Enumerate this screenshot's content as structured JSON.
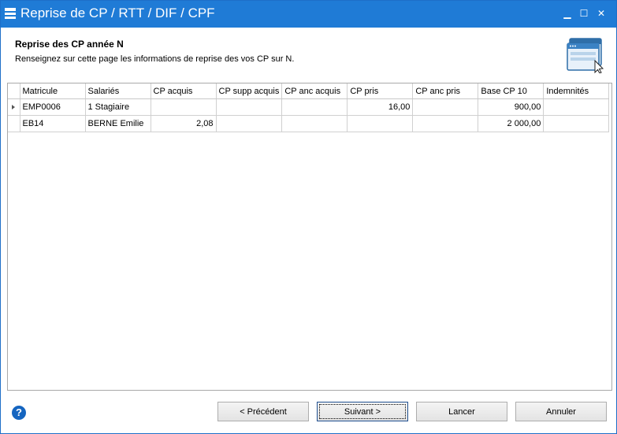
{
  "window": {
    "title": "Reprise de CP / RTT / DIF / CPF",
    "minimize_symbol": "▁",
    "maximize_symbol": "☐",
    "close_symbol": "✕"
  },
  "header": {
    "title": "Reprise des CP année N",
    "subtitle": "Renseignez sur cette page les informations de reprise des vos CP sur N.",
    "icon": "wizard-window-icon"
  },
  "grid": {
    "columns": [
      "Matricule",
      "Salariés",
      "CP acquis",
      "CP supp acquis",
      "CP anc acquis",
      "CP pris",
      "CP anc pris",
      "Base CP 10",
      "Indemnités"
    ],
    "rows": [
      {
        "current": true,
        "cells": [
          "EMP0006",
          "1 Stagiaire",
          "",
          "",
          "",
          "16,00",
          "",
          "900,00",
          ""
        ]
      },
      {
        "current": false,
        "cells": [
          "EB14",
          "BERNE Emilie",
          "2,08",
          "",
          "",
          "",
          "",
          "2 000,00",
          ""
        ]
      }
    ]
  },
  "footer": {
    "help_symbol": "?",
    "previous_label": "< Précédent",
    "next_label": "Suivant >",
    "launch_label": "Lancer",
    "cancel_label": "Annuler"
  },
  "colors": {
    "titlebar": "#1f7bd6",
    "help": "#1565c0"
  }
}
